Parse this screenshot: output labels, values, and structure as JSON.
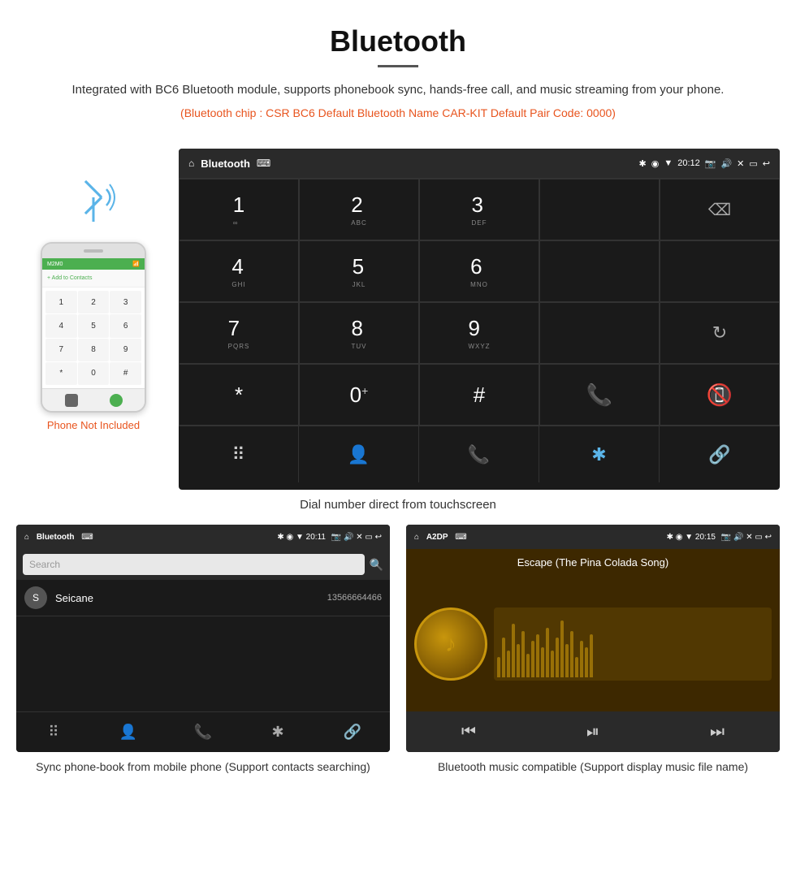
{
  "header": {
    "title": "Bluetooth",
    "description": "Integrated with BC6 Bluetooth module, supports phonebook sync, hands-free call, and music streaming from your phone.",
    "bt_info": "(Bluetooth chip : CSR BC6    Default Bluetooth Name CAR-KIT    Default Pair Code: 0000)"
  },
  "main_screen": {
    "status_bar": {
      "left": "🏠",
      "center": "Bluetooth",
      "usb_icon": "⌨",
      "time": "20:12",
      "icons_right": "📷 🔊 ✕ ▭ ↩"
    },
    "keypad": [
      {
        "num": "1",
        "letters": "∞"
      },
      {
        "num": "2",
        "letters": "ABC"
      },
      {
        "num": "3",
        "letters": "DEF"
      },
      {
        "num": "",
        "letters": ""
      },
      {
        "num": "",
        "letters": ""
      },
      {
        "num": "4",
        "letters": "GHI"
      },
      {
        "num": "5",
        "letters": "JKL"
      },
      {
        "num": "6",
        "letters": "MNO"
      },
      {
        "num": "",
        "letters": ""
      },
      {
        "num": "",
        "letters": ""
      },
      {
        "num": "7",
        "letters": "PQRS"
      },
      {
        "num": "8",
        "letters": "TUV"
      },
      {
        "num": "9",
        "letters": "WXYZ"
      },
      {
        "num": "",
        "letters": ""
      },
      {
        "num": "",
        "letters": ""
      },
      {
        "num": "*",
        "letters": ""
      },
      {
        "num": "0",
        "letters": "+"
      },
      {
        "num": "#",
        "letters": ""
      },
      {
        "num": "",
        "letters": ""
      },
      {
        "num": "",
        "letters": ""
      }
    ],
    "nav_items": [
      "⠿",
      "👤",
      "📞",
      "✱",
      "🔗"
    ]
  },
  "dial_caption": "Dial number direct from touchscreen",
  "phone_not_included": "Phone Not Included",
  "phonebook_screen": {
    "status_bar_left": "🏠 Bluetooth ⌨",
    "status_bar_right": "✱ ◉ ▼ 20:11 📷 🔊 ✕ ▭ ↩",
    "search_placeholder": "Search",
    "contact": {
      "initial": "S",
      "name": "Seicane",
      "number": "13566664466"
    },
    "caption": "Sync phone-book from mobile phone\n(Support contacts searching)"
  },
  "music_screen": {
    "status_bar_left": "🏠 A2DP ⌨",
    "status_bar_right": "✱ ◉ ▼ 20:15 📷 🔊 ✕ ▭ ↩",
    "song_title": "Escape (The Pina Colada Song)",
    "caption": "Bluetooth music compatible\n(Support display music file name)"
  }
}
